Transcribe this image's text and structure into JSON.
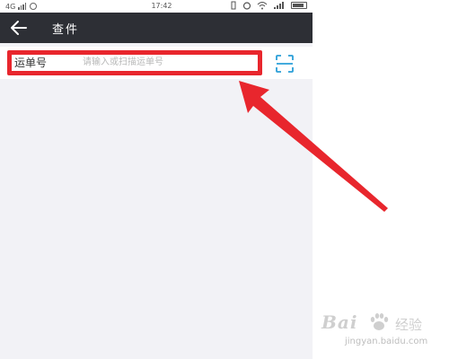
{
  "statusbar": {
    "network": "4G",
    "time": "17:42"
  },
  "navbar": {
    "title": "查件",
    "back_icon": "arrow-left-icon"
  },
  "form": {
    "label": "运单号",
    "input_value": "",
    "input_placeholder": "请输入或扫描运单号",
    "scan_icon": "scan-icon"
  },
  "annotation": {
    "highlight_color": "#e8262d"
  },
  "watermark": {
    "brand": "Bai",
    "brand_cn": "经验",
    "url": "jingyan.baidu.com"
  },
  "colors": {
    "navbar_bg": "#2d2f35",
    "page_bg": "#f2f2f6",
    "scan_icon": "#2a9fd8",
    "highlight": "#e8262d"
  }
}
